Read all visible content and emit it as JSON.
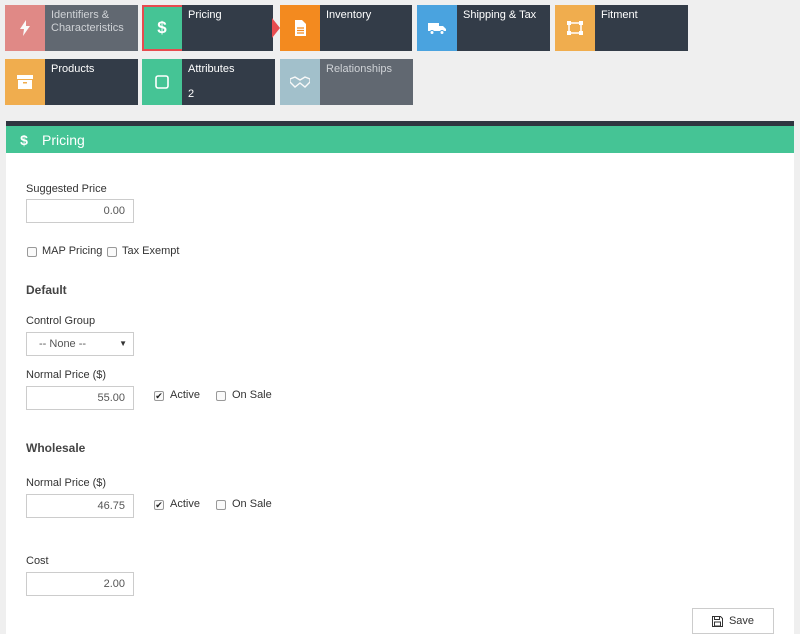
{
  "tiles": [
    {
      "label": "Identifiers & Characteristics",
      "icon": "bolt-icon",
      "color": "#d9534f",
      "state": "faded"
    },
    {
      "label": "Pricing",
      "icon": "dollar-icon",
      "color": "#45c495",
      "state": "active"
    },
    {
      "label": "Inventory",
      "icon": "document-icon",
      "color": "#f38a1f",
      "state": "normal"
    },
    {
      "label": "Shipping & Tax",
      "icon": "truck-icon",
      "color": "#4aa3df",
      "state": "normal"
    },
    {
      "label": "Fitment",
      "icon": "fitment-icon",
      "color": "#f0ad4e",
      "state": "normal"
    },
    {
      "label": "Products",
      "icon": "archive-icon",
      "color": "#f0ad4e",
      "state": "normal"
    },
    {
      "label": "Attributes",
      "sub": "2",
      "icon": "square-icon",
      "color": "#45c495",
      "state": "normal"
    },
    {
      "label": "Relationships",
      "icon": "handshake-icon",
      "color": "#7aa8b8",
      "state": "faded"
    }
  ],
  "panel": {
    "title": "Pricing",
    "icon": "$"
  },
  "form": {
    "suggested_label": "Suggested Price",
    "suggested_value": "0.00",
    "map_pricing": {
      "label": "MAP Pricing",
      "checked": false
    },
    "tax_exempt": {
      "label": "Tax Exempt",
      "checked": false
    },
    "default": {
      "heading": "Default",
      "control_group_label": "Control Group",
      "control_group_value": "-- None --",
      "normal_price_label": "Normal Price ($)",
      "normal_price_value": "55.00",
      "active": {
        "label": "Active",
        "checked": true
      },
      "on_sale": {
        "label": "On Sale",
        "checked": false
      }
    },
    "wholesale": {
      "heading": "Wholesale",
      "normal_price_label": "Normal Price ($)",
      "normal_price_value": "46.75",
      "active": {
        "label": "Active",
        "checked": true
      },
      "on_sale": {
        "label": "On Sale",
        "checked": false
      }
    },
    "cost_label": "Cost",
    "cost_value": "2.00",
    "save_label": "Save"
  }
}
